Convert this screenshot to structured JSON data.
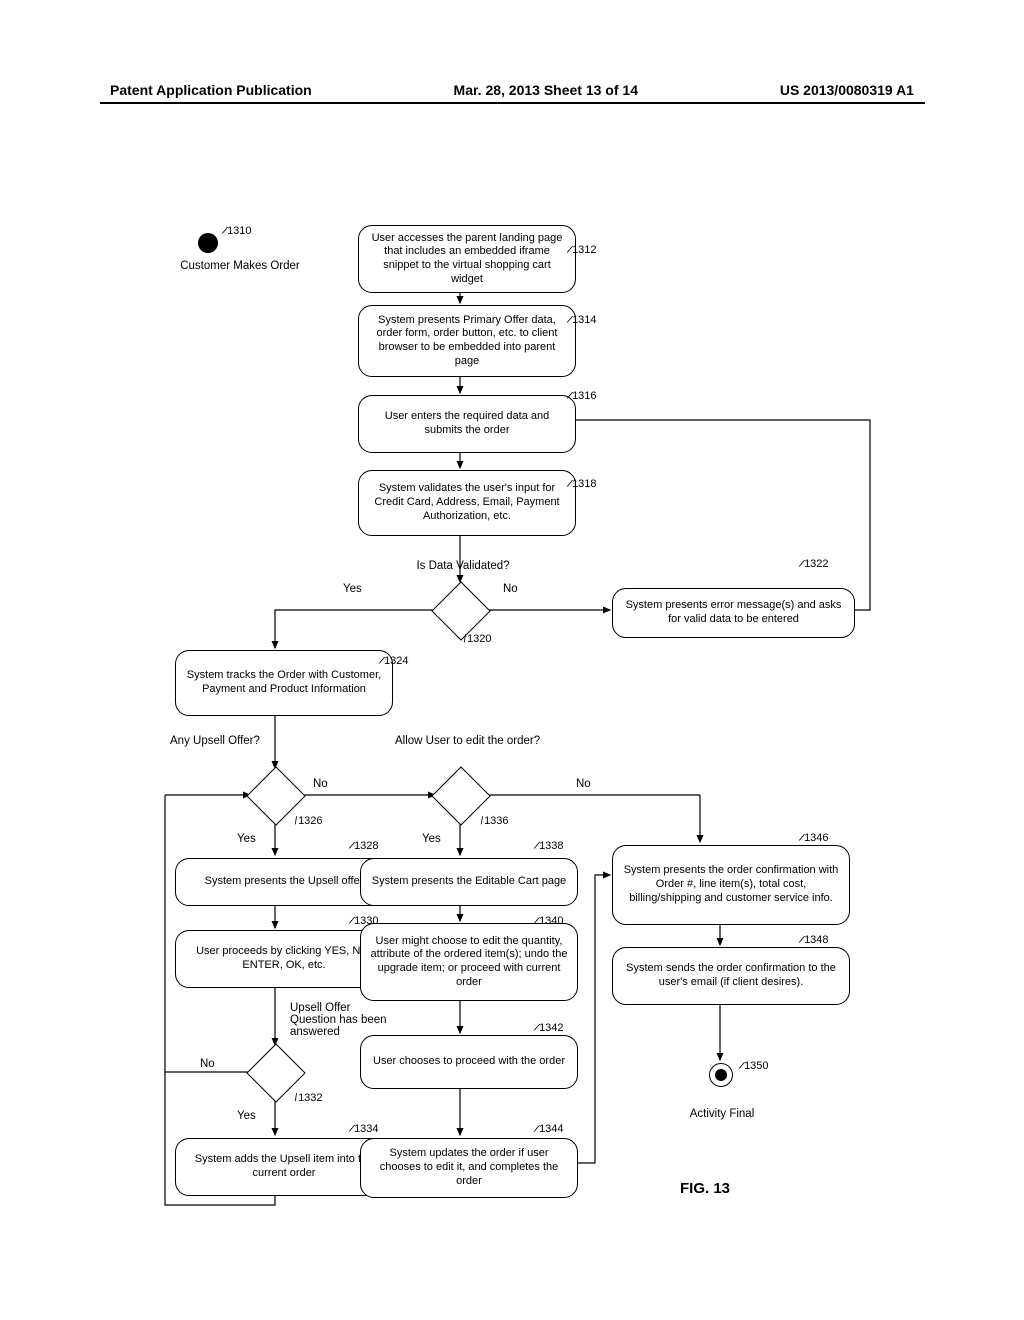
{
  "header": {
    "left": "Patent Application Publication",
    "center": "Mar. 28, 2013  Sheet 13 of 14",
    "right": "US 2013/0080319 A1"
  },
  "figure_label": "FIG. 13",
  "start_label": "Customer Makes Order",
  "end_label": "Activity Final",
  "refs": {
    "r1310": "1310",
    "r1312": "1312",
    "r1314": "1314",
    "r1316": "1316",
    "r1318": "1318",
    "r1320": "1320",
    "r1322": "1322",
    "r1324": "1324",
    "r1326": "1326",
    "r1328": "1328",
    "r1330": "1330",
    "r1332": "1332",
    "r1334": "1334",
    "r1336": "1336",
    "r1338": "1338",
    "r1340": "1340",
    "r1342": "1342",
    "r1344": "1344",
    "r1346": "1346",
    "r1348": "1348",
    "r1350": "1350"
  },
  "boxes": {
    "b1312": "User accesses the parent landing page that includes an embedded iframe snippet to the virtual shopping cart widget",
    "b1314": "System presents Primary Offer data, order form, order button, etc. to client browser to be embedded into parent page",
    "b1316": "User enters the required data and submits the order",
    "b1318": "System validates the user's input for Credit Card, Address, Email, Payment Authorization, etc.",
    "b1322": "System presents error message(s) and asks for valid data to be entered",
    "b1324": "System tracks the Order with Customer, Payment and Product Information",
    "b1328": "System presents the Upsell offer",
    "b1330": "User proceeds by clicking YES, NO, ENTER, OK, etc.",
    "b1334": "System adds the Upsell item into the current order",
    "b1338": "System presents the Editable Cart page",
    "b1340": "User might choose to edit the quantity, attribute of the ordered item(s); undo the upgrade item; or proceed with current order",
    "b1342": "User chooses to proceed with the order",
    "b1344": "System updates the order if user chooses to edit it, and completes the order",
    "b1346": "System presents the order confirmation with Order #, line item(s), total cost, billing/shipping and customer service info.",
    "b1348": "System sends the order confirmation to the user's email (if client desires)."
  },
  "questions": {
    "q1320": "Is Data Validated?",
    "q1326": "Any Upsell Offer?",
    "q1332": "Upsell Offer Question has been answered",
    "q1336": "Allow User to edit the order?"
  },
  "edges": {
    "yes": "Yes",
    "no": "No"
  }
}
